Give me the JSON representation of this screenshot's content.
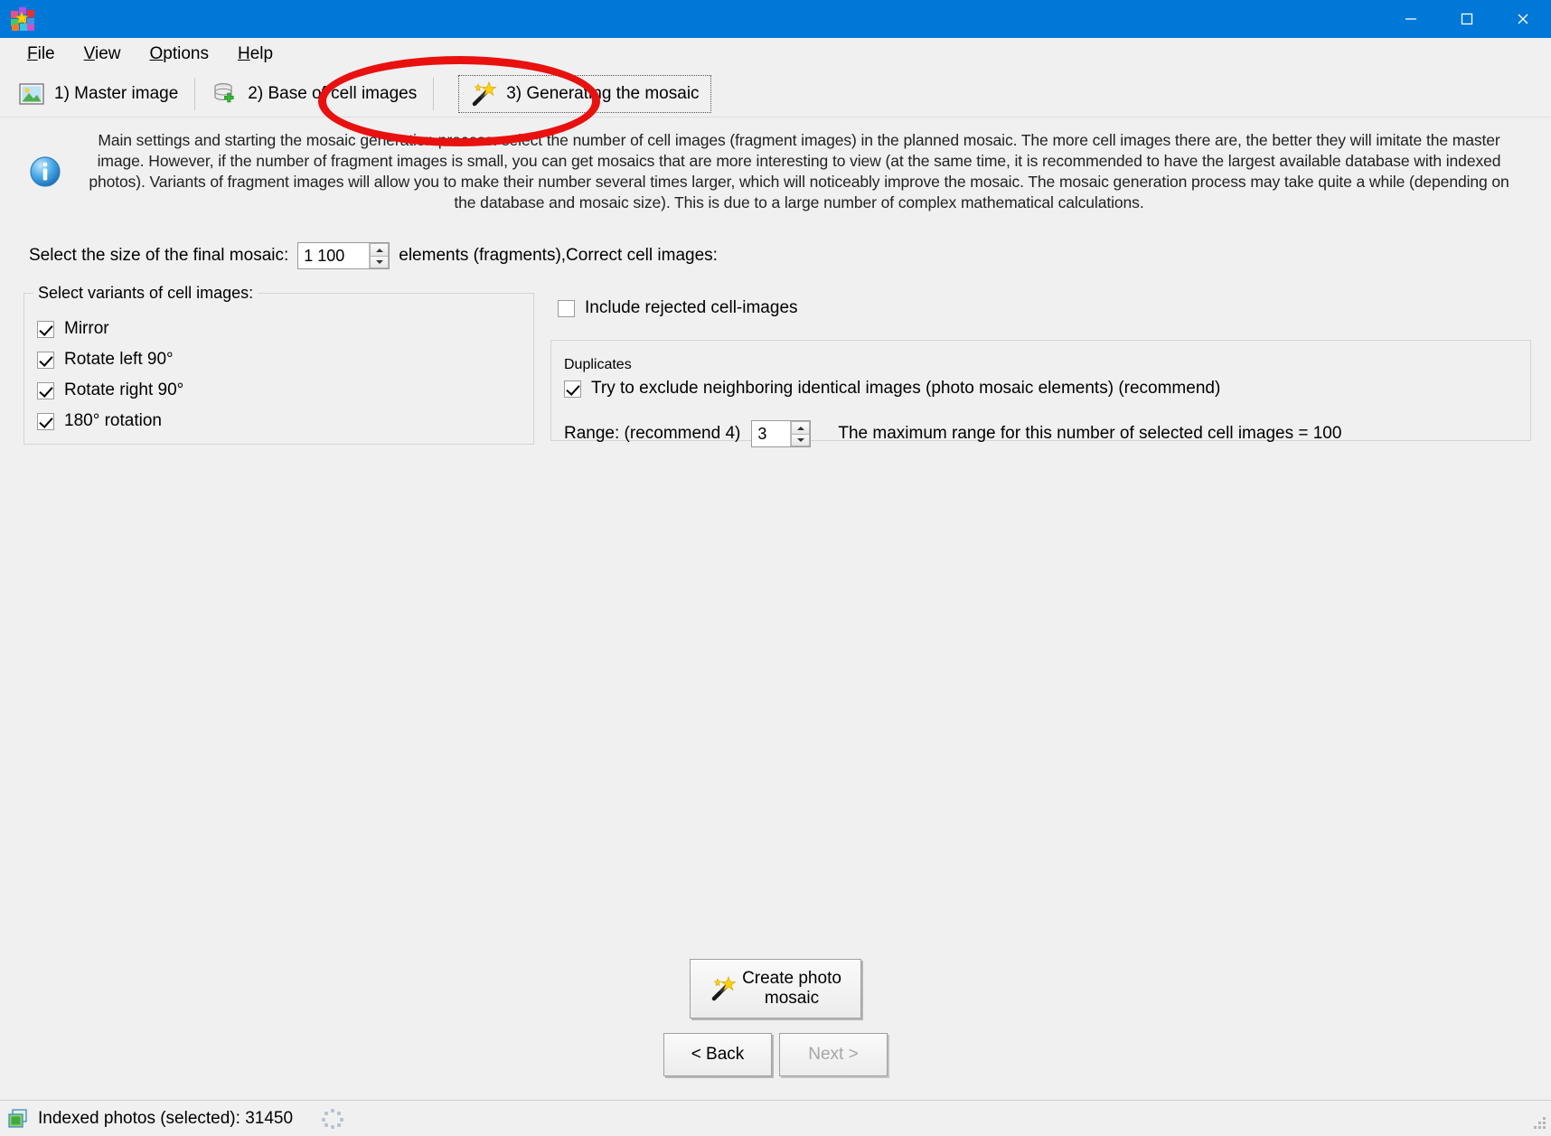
{
  "window": {
    "title": "",
    "icon": "mosaic-app-icon",
    "controls": {
      "minimize": "minimize-icon",
      "maximize": "maximize-icon",
      "close": "close-icon"
    }
  },
  "menubar": {
    "items": [
      {
        "label": "File",
        "accel": "F"
      },
      {
        "label": "View",
        "accel": "V"
      },
      {
        "label": "Options",
        "accel": "O"
      },
      {
        "label": "Help",
        "accel": "H"
      }
    ]
  },
  "tabs": [
    {
      "label": "1) Master image",
      "icon": "picture-icon",
      "selected": false
    },
    {
      "label": "2) Base of cell images",
      "icon": "database-add-icon",
      "selected": false
    },
    {
      "label": "3) Generating the mosaic",
      "icon": "magic-wand-icon",
      "selected": true
    }
  ],
  "info": {
    "icon": "info-icon",
    "text": "Main settings and starting the mosaic generation process: select the number of cell images (fragment images) in the planned mosaic. The more cell images there are, the better they will imitate the master image. However, if the number of fragment images is small, you can get mosaics that are more interesting to view (at the same time, it is recommended to have the largest available database with indexed photos). Variants of fragment images will allow you to make their number several times larger, which will noticeably improve the mosaic. The mosaic generation process may take quite a while (depending on the database and mosaic size). This is due to a large number of complex mathematical calculations."
  },
  "size_row": {
    "label": "Select the size of the final mosaic:",
    "value": "1 100",
    "suffix": "elements (fragments),Correct cell images:"
  },
  "variants_group": {
    "title": "Select variants of cell images:",
    "items": [
      {
        "label": "Mirror",
        "checked": true
      },
      {
        "label": "Rotate left 90°",
        "checked": true
      },
      {
        "label": "Rotate right 90°",
        "checked": true
      },
      {
        "label": "180° rotation",
        "checked": true
      }
    ]
  },
  "right_panel": {
    "include_rejected": {
      "label": "Include rejected cell-images",
      "checked": false
    },
    "duplicates": {
      "title": "Duplicates",
      "exclude_neighbors": {
        "label": "Try to exclude neighboring identical images (photo mosaic elements) (recommend)",
        "checked": true
      },
      "range_label": "Range: (recommend 4)",
      "range_value": "3",
      "max_range_note": "The maximum range for this number of selected cell images = 100"
    }
  },
  "buttons": {
    "create": {
      "line1": "Create photo",
      "line2": "mosaic",
      "icon": "magic-wand-icon"
    },
    "back": {
      "label": "< Back",
      "enabled": true
    },
    "next": {
      "label": "Next >",
      "enabled": false
    }
  },
  "statusbar": {
    "icon": "indexed-photos-icon",
    "text": "Indexed photos (selected): 31450",
    "busy_indicator": "spinner-dots",
    "grip": "resize-grip"
  },
  "annotation": {
    "shape": "ellipse",
    "color": "#e8110f",
    "target": "tab-generating-the-mosaic"
  },
  "colors": {
    "titlebar": "#0078d7",
    "window_bg": "#f0f0f0",
    "annotation_red": "#e8110f",
    "text": "#000000"
  }
}
